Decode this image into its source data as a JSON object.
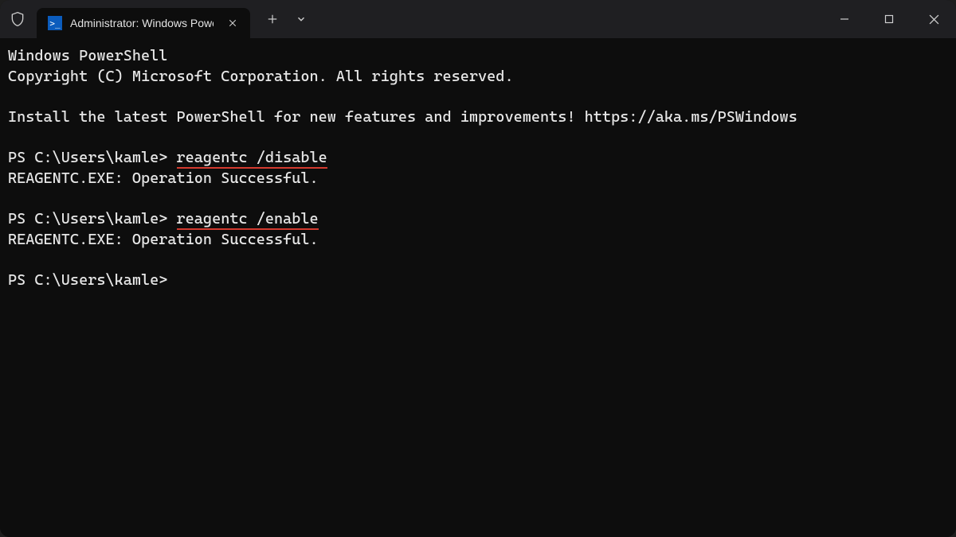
{
  "titlebar": {
    "tab_label": "Administrator: Windows Powe",
    "tab_icon": "powershell-icon",
    "shield_icon": "shield-outline-icon",
    "close_icon": "x",
    "new_tab_icon": "+",
    "dropdown_icon": "chevron-down",
    "window_controls": {
      "minimize_icon": "minimize",
      "maximize_icon": "maximize",
      "close_icon": "close"
    }
  },
  "terminal": {
    "lines": [
      {
        "type": "text",
        "content": "Windows PowerShell"
      },
      {
        "type": "text",
        "content": "Copyright (C) Microsoft Corporation. All rights reserved."
      },
      {
        "type": "blank"
      },
      {
        "type": "text",
        "content": "Install the latest PowerShell for new features and improvements! https://aka.ms/PSWindows"
      },
      {
        "type": "blank"
      },
      {
        "type": "prompt",
        "prompt": "PS C:\\Users\\kamle> ",
        "cmd_parts": [
          "reagentc",
          " /disable"
        ],
        "underline": true
      },
      {
        "type": "text",
        "content": "REAGENTC.EXE: Operation Successful."
      },
      {
        "type": "blank"
      },
      {
        "type": "prompt",
        "prompt": "PS C:\\Users\\kamle> ",
        "cmd_parts": [
          "reagentc",
          " /enable"
        ],
        "underline": true
      },
      {
        "type": "text",
        "content": "REAGENTC.EXE: Operation Successful."
      },
      {
        "type": "blank"
      },
      {
        "type": "prompt",
        "prompt": "PS C:\\Users\\kamle>",
        "cmd_parts": [],
        "underline": false
      }
    ]
  }
}
